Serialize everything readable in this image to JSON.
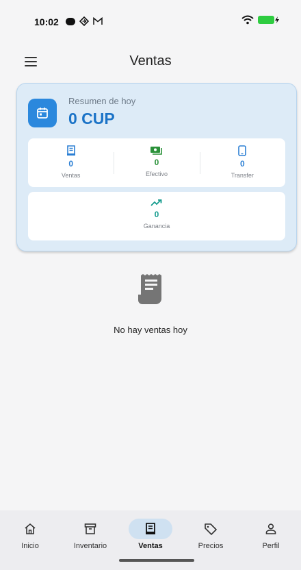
{
  "status_bar": {
    "time": "10:02",
    "icons": [
      "record-dot-icon",
      "location-icon",
      "gmail-icon",
      "wifi-icon",
      "battery-charging-icon"
    ]
  },
  "app_bar": {
    "title": "Ventas",
    "menu_icon": "menu-icon"
  },
  "summary": {
    "label": "Resumen de hoy",
    "total": "0 CUP",
    "icon": "calendar-icon",
    "stats": [
      {
        "value": "0",
        "label": "Ventas",
        "icon": "receipt-icon",
        "color": "#2b7fd4"
      },
      {
        "value": "0",
        "label": "Efectivo",
        "icon": "cash-icon",
        "color": "#2a9139"
      },
      {
        "value": "0",
        "label": "Transfer",
        "icon": "phone-icon",
        "color": "#2b7fd4"
      }
    ],
    "profit": {
      "value": "0",
      "label": "Ganancia",
      "icon": "trending-up-icon",
      "color": "#169c8e"
    }
  },
  "empty_state": {
    "icon": "receipt-long-icon",
    "text": "No hay ventas hoy"
  },
  "bottom_nav": {
    "items": [
      {
        "label": "Inicio",
        "icon": "home-icon",
        "active": false
      },
      {
        "label": "Inventario",
        "icon": "archive-icon",
        "active": false
      },
      {
        "label": "Ventas",
        "icon": "receipt-icon",
        "active": true
      },
      {
        "label": "Precios",
        "icon": "tag-icon",
        "active": false
      },
      {
        "label": "Perfil",
        "icon": "person-icon",
        "active": false
      }
    ]
  },
  "colors": {
    "accent": "#2b88dd",
    "card_bg": "#ddebf7",
    "nav_active_bg": "#cfe1f1"
  }
}
